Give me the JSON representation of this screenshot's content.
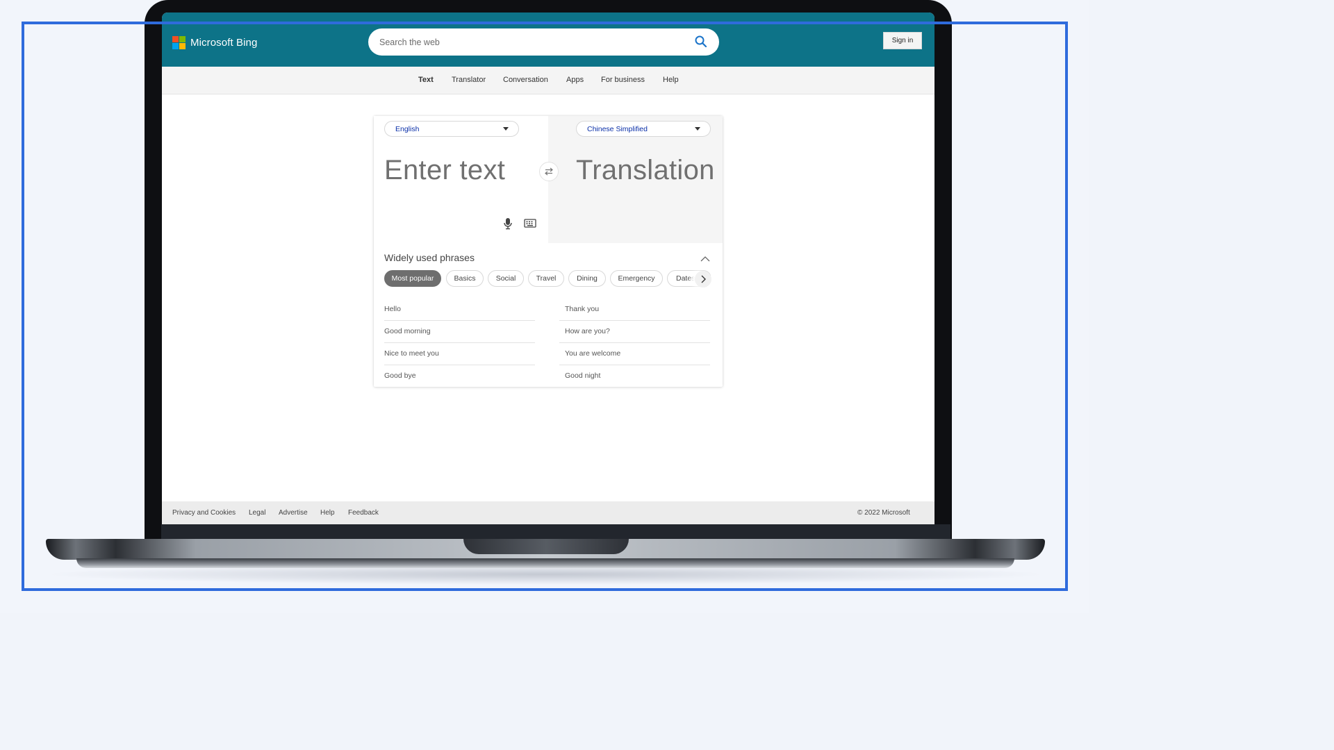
{
  "header": {
    "brand": "Microsoft Bing",
    "brand_colors": [
      "#f25022",
      "#7fba00",
      "#00a4ef",
      "#ffb900"
    ],
    "search_placeholder": "Search the web",
    "search_icon": "search-icon",
    "signin_label": "Sign in",
    "bg_color": "#0d7388"
  },
  "nav": {
    "items": [
      "Text",
      "Translator",
      "Conversation",
      "Apps",
      "For business",
      "Help"
    ],
    "active": "Text"
  },
  "translator": {
    "source_lang": "English",
    "target_lang": "Chinese Simplified",
    "input_placeholder": "Enter text",
    "output_placeholder": "Translation",
    "swap_icon": "swap-icon",
    "mic_icon": "microphone-icon",
    "keyboard_icon": "keyboard-icon"
  },
  "phrases": {
    "title": "Widely used phrases",
    "collapse_icon": "chevron-up-icon",
    "categories": [
      "Most popular",
      "Basics",
      "Social",
      "Travel",
      "Dining",
      "Emergency",
      "Dates"
    ],
    "active_category": "Most popular",
    "next_icon": "chevron-right-icon",
    "left_column": [
      "Hello",
      "Good morning",
      "Nice to meet you",
      "Good bye"
    ],
    "right_column": [
      "Thank you",
      "How are you?",
      "You are welcome",
      "Good night"
    ]
  },
  "footer": {
    "links": [
      "Privacy and Cookies",
      "Legal",
      "Advertise",
      "Help",
      "Feedback"
    ],
    "copyright": "© 2022 Microsoft"
  },
  "frame_color": "#2f6bdc"
}
